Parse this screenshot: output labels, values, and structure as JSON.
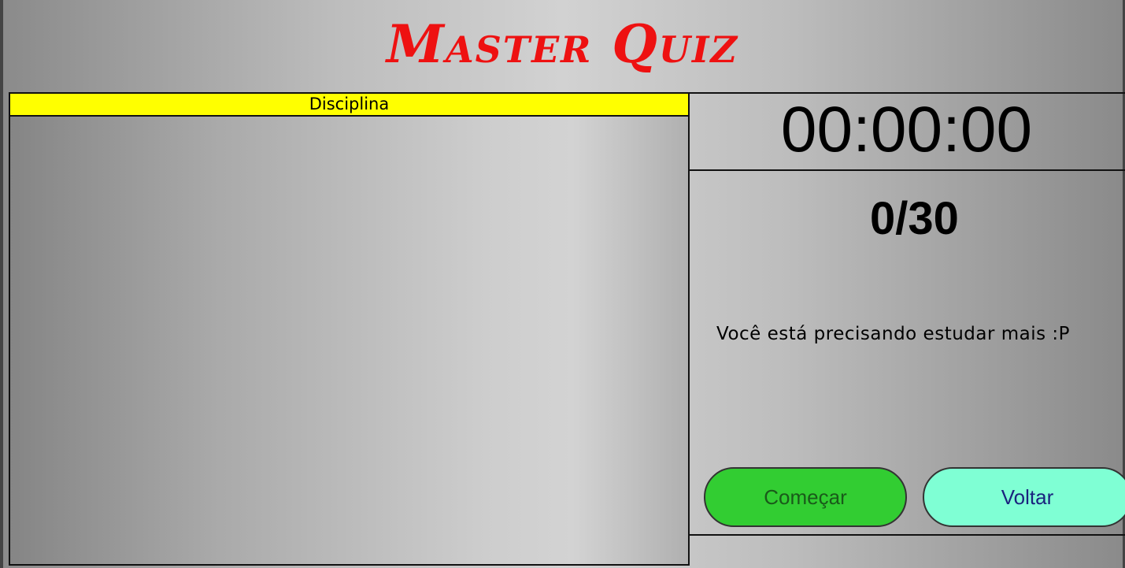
{
  "app": {
    "title": "Master Quiz"
  },
  "discipline": {
    "header": "Disciplina"
  },
  "status": {
    "timer": "00:00:00",
    "score": "0/30",
    "message": "Você está precisando estudar mais :P"
  },
  "actions": {
    "start_label": "Começar",
    "back_label": "Voltar"
  },
  "colors": {
    "title": "#ee1111",
    "header_bg": "#ffff00",
    "start_bg": "#32cd32",
    "back_bg": "#7fffd4"
  }
}
